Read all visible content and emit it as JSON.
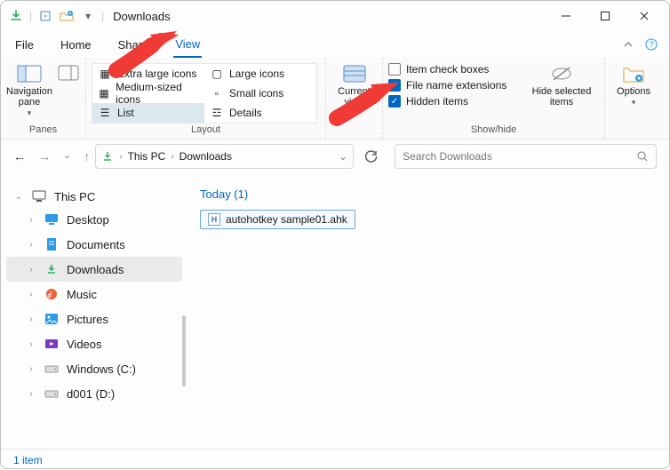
{
  "titlebar": {
    "title": "Downloads"
  },
  "menubar": {
    "items": [
      "File",
      "Home",
      "Share",
      "View"
    ],
    "active": "View"
  },
  "ribbon": {
    "panes": {
      "nav_label": "Navigation pane",
      "group": "Panes"
    },
    "layout": {
      "group": "Layout",
      "items": [
        {
          "label": "Extra large icons"
        },
        {
          "label": "Large icons"
        },
        {
          "label": "Medium-sized icons"
        },
        {
          "label": "Small icons"
        },
        {
          "label": "List",
          "selected": true
        },
        {
          "label": "Details"
        }
      ]
    },
    "currentview": {
      "label": "Current view"
    },
    "showhide": {
      "group": "Show/hide",
      "checks": [
        {
          "label": "Item check boxes",
          "checked": false
        },
        {
          "label": "File name extensions",
          "checked": true
        },
        {
          "label": "Hidden items",
          "checked": true
        }
      ],
      "hideselected": "Hide selected items"
    },
    "options": {
      "label": "Options"
    }
  },
  "address": {
    "crumbs": [
      "This PC",
      "Downloads"
    ]
  },
  "search": {
    "placeholder": "Search Downloads"
  },
  "sidebar": {
    "root": "This PC",
    "items": [
      {
        "label": "Desktop",
        "icon": "desktop",
        "color": "#2e9ae6"
      },
      {
        "label": "Documents",
        "icon": "doc",
        "color": "#2e9ae6"
      },
      {
        "label": "Downloads",
        "icon": "download",
        "color": "#2db364",
        "sel": true
      },
      {
        "label": "Music",
        "icon": "music",
        "color": "#e86138"
      },
      {
        "label": "Pictures",
        "icon": "pic",
        "color": "#2e9ae6"
      },
      {
        "label": "Videos",
        "icon": "video",
        "color": "#7a3abf"
      },
      {
        "label": "Windows (C:)",
        "icon": "drive",
        "color": "#888"
      },
      {
        "label": "d001 (D:)",
        "icon": "drive",
        "color": "#888"
      }
    ]
  },
  "main": {
    "group_title": "Today (1)",
    "files": [
      {
        "name": "autohotkey sample01.ahk"
      }
    ]
  },
  "status": {
    "text": "1 item"
  }
}
